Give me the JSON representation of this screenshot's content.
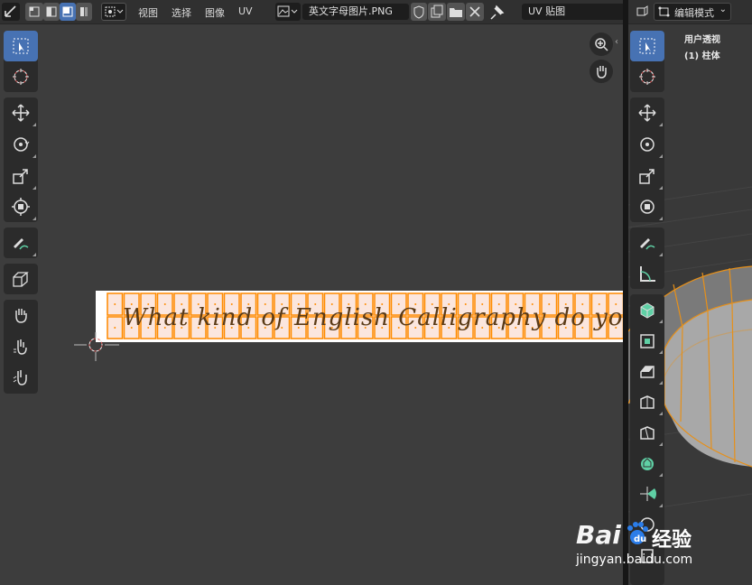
{
  "uv_header": {
    "menus": [
      "视图",
      "选择",
      "图像",
      "UV"
    ],
    "image_name": "英文字母图片.PNG",
    "uv_map_label": "UV 贴图"
  },
  "viewport_header": {
    "mode": "编辑模式"
  },
  "viewport_overlay": {
    "view_name": "用户透视",
    "object_name": "(1) 柱体"
  },
  "uv_image": {
    "text": "What kind of English Calligraphy do you like?"
  },
  "uv_toolbar": {
    "tools": [
      "select-box-icon",
      "cursor-icon",
      "move-icon",
      "rotate-icon",
      "scale-icon",
      "transform-icon",
      "annotate-icon",
      "uv-transform-icon",
      "grab-icon",
      "relax-icon",
      "pinch-icon"
    ]
  },
  "viewport_toolbar": {
    "tools": [
      "select-box-icon",
      "cursor-icon",
      "move-icon",
      "rotate-icon",
      "scale-icon",
      "transform-icon",
      "annotate-icon",
      "measure-icon",
      "add-cube-icon",
      "extrude-icon",
      "inset-icon",
      "bevel-icon",
      "loop-cut-icon",
      "knife-icon",
      "poly-build-icon",
      "spin-icon",
      "smooth-icon"
    ]
  },
  "watermark": {
    "brand": "Bai",
    "brand_tail": "经验",
    "url": "jingyan.baidu.com"
  },
  "colors": {
    "accent": "#4772b3",
    "uv_edge": "#ff8c00",
    "mesh_edge": "#e6901a"
  }
}
